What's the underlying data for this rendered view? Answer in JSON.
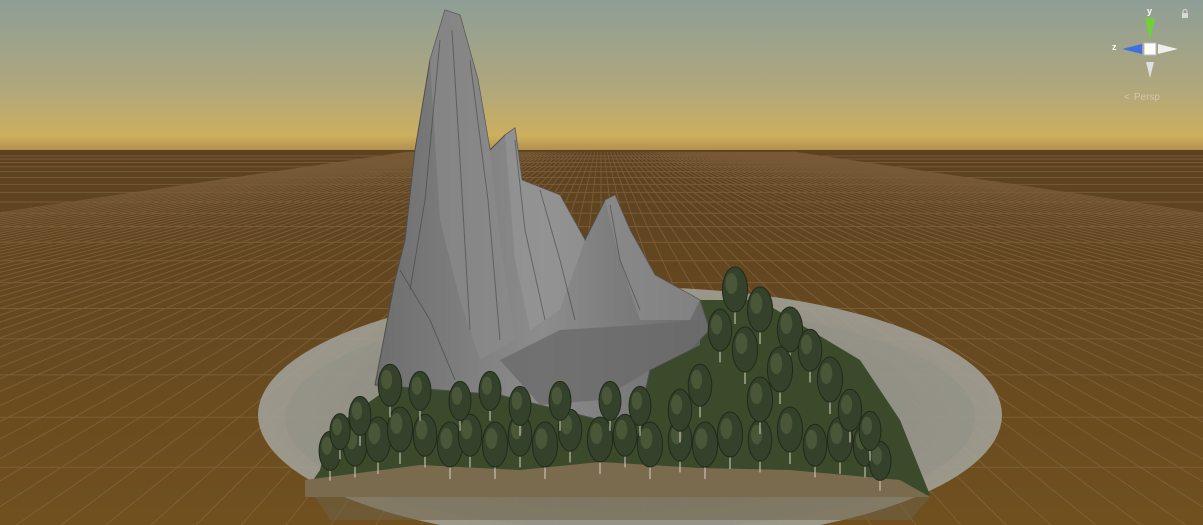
{
  "viewport": {
    "mode": "Scene View",
    "projection_label": "Persp"
  },
  "gizmo": {
    "y_label": "y",
    "z_label": "z",
    "colors": {
      "y": "#6fd13a",
      "z": "#3f6fe0",
      "x_neg": "#e8e8e8",
      "center": "#ffffff"
    }
  },
  "colors": {
    "sky_top": "#8f9f96",
    "sky_horizon": "#c9ad62",
    "ground": "#6b4a22",
    "grid_line": "#8a6a45",
    "water": "#9c9f98",
    "rock": "#7a7a7a",
    "trees": "#34402a"
  },
  "icons": [
    "lock-icon",
    "back-arrow-icon",
    "scene-orientation-gizmo"
  ]
}
